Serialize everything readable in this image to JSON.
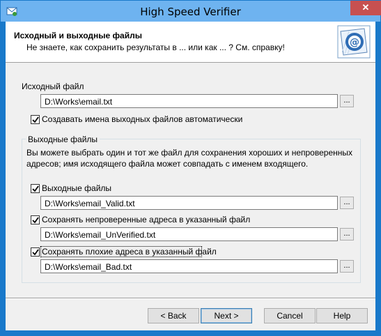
{
  "window": {
    "title": "High Speed Verifier",
    "close_glyph": "✕"
  },
  "header": {
    "title": "Исходный и выходные файлы",
    "subtitle": "Не знаете, как сохранить результаты в ... или как ... ? См. справку!"
  },
  "source": {
    "label": "Исходный файл",
    "path": "D:\\Works\\email.txt",
    "browse_label": "...",
    "auto_names_label": "Создавать имена выходных файлов автоматически",
    "auto_names_checked": true
  },
  "output_group": {
    "legend": "Выходные файлы",
    "description_line1": "Вы можете выбрать один и тот же файл для сохранения хороших и непроверенных",
    "description_line2": "адресов; имя исходящего файла может совпадать с именем входящего.",
    "items": [
      {
        "label": "Выходные файлы",
        "checked": true,
        "path": "D:\\Works\\email_Valid.txt",
        "browse_label": "..."
      },
      {
        "label": "Сохранять непроверенные адреса в указанный файл",
        "checked": true,
        "path": "D:\\Works\\email_UnVerified.txt",
        "browse_label": "..."
      },
      {
        "label": "Сохранять плохие адреса в указанный файл",
        "checked": true,
        "path": "D:\\Works\\email_Bad.txt",
        "browse_label": "..."
      }
    ]
  },
  "buttons": {
    "back": "< Back",
    "next": "Next >",
    "cancel": "Cancel",
    "help": "Help"
  },
  "icons": [
    "app-icon",
    "email-at-icon",
    "checkmark-icon",
    "close-icon"
  ]
}
